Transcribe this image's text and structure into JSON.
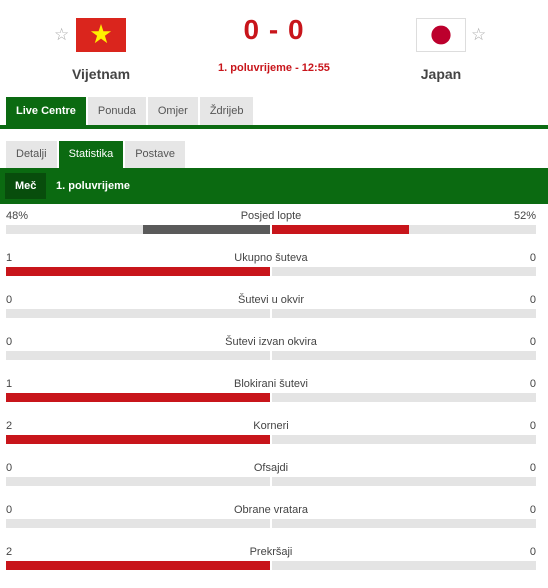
{
  "match": {
    "home_team": "Vijetnam",
    "away_team": "Japan",
    "score": "0 - 0",
    "status": "1. poluvrijeme - 12:55",
    "home_flag": "vietnam-flag",
    "away_flag": "japan-flag"
  },
  "main_tabs": [
    "Live Centre",
    "Ponuda",
    "Omjer",
    "Ždrijeb"
  ],
  "sub_tabs": [
    "Detalji",
    "Statistika",
    "Postave"
  ],
  "period_tabs": [
    "Meč",
    "1. poluvrijeme"
  ],
  "colors": {
    "brand_green": "#0b6a11",
    "accent_red": "#c8151b",
    "bar_grey": "#e4e4e4",
    "possession_home": "#5a5a5a"
  },
  "stats": [
    {
      "name": "Posjed lopte",
      "home": "48%",
      "away": "52%",
      "home_share": 0.48,
      "away_share": 0.52
    },
    {
      "name": "Ukupno šuteva",
      "home": "1",
      "away": "0",
      "home_share": 1,
      "away_share": 0
    },
    {
      "name": "Šutevi u okvir",
      "home": "0",
      "away": "0",
      "home_share": 0,
      "away_share": 0
    },
    {
      "name": "Šutevi izvan okvira",
      "home": "0",
      "away": "0",
      "home_share": 0,
      "away_share": 0
    },
    {
      "name": "Blokirani šutevi",
      "home": "1",
      "away": "0",
      "home_share": 1,
      "away_share": 0
    },
    {
      "name": "Korneri",
      "home": "2",
      "away": "0",
      "home_share": 1,
      "away_share": 0
    },
    {
      "name": "Ofsajdi",
      "home": "0",
      "away": "0",
      "home_share": 0,
      "away_share": 0
    },
    {
      "name": "Obrane vratara",
      "home": "0",
      "away": "0",
      "home_share": 0,
      "away_share": 0
    },
    {
      "name": "Prekršaji",
      "home": "2",
      "away": "0",
      "home_share": 1,
      "away_share": 0
    }
  ]
}
